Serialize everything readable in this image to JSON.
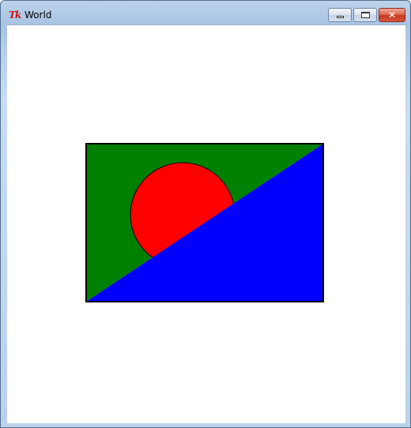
{
  "window": {
    "title": "World",
    "app_icon": "tk-feather-icon",
    "buttons": {
      "minimize": "minimize-icon",
      "maximize": "maximize-icon",
      "close": "close-icon",
      "close_glyph": "✕"
    }
  },
  "canvas": {
    "background": "#ffffff",
    "flag": {
      "upper_triangle_color": "#008000",
      "lower_triangle_color": "#0000ff",
      "circle_color": "#ff0000",
      "outline_color": "#000000"
    }
  }
}
